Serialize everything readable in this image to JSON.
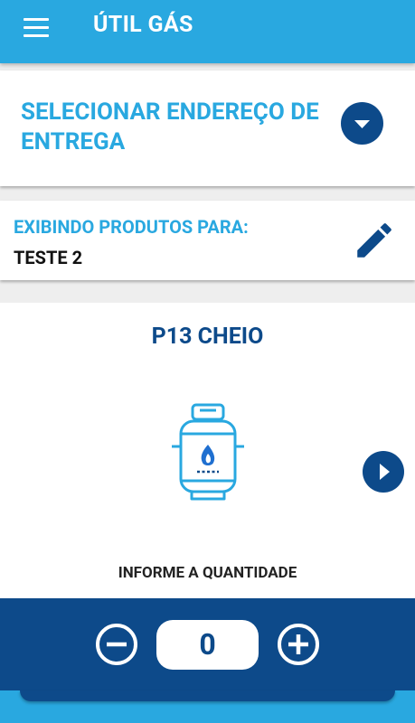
{
  "app": {
    "title": "ÚTIL GÁS",
    "colors": {
      "primary": "#29a8e0",
      "dark": "#0d4a8a"
    }
  },
  "address": {
    "label": "SELECIONAR ENDEREÇO DE ENTREGA"
  },
  "showing": {
    "label": "EXIBINDO PRODUTOS PARA:",
    "value": "TESTE 2"
  },
  "product": {
    "name": "P13 CHEIO",
    "quantity_label": "INFORME A QUANTIDADE",
    "quantity": "0"
  },
  "icons": [
    "menu-icon",
    "chevron-down-icon",
    "edit-pencil-icon",
    "gas-cylinder-icon",
    "play-icon",
    "minus-circle-icon",
    "plus-circle-icon"
  ]
}
